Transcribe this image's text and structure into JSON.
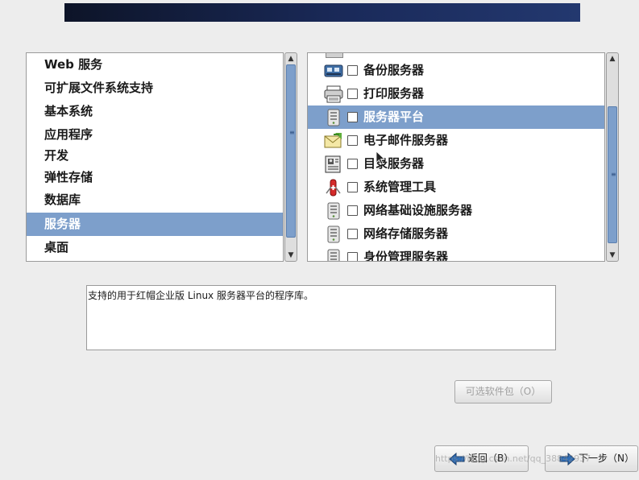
{
  "left_list": {
    "items": [
      {
        "label": "Web 服务"
      },
      {
        "label": "可扩展文件系统支持"
      },
      {
        "label": "基本系统"
      },
      {
        "label": "应用程序"
      },
      {
        "label": "开发"
      },
      {
        "label": "弹性存储"
      },
      {
        "label": "数据库"
      },
      {
        "label": "服务器",
        "selected": true
      },
      {
        "label": "桌面"
      }
    ]
  },
  "right_list": {
    "items": [
      {
        "label": "备份服务器",
        "icon": "backup-server-icon",
        "checked": false
      },
      {
        "label": "打印服务器",
        "icon": "printer-icon",
        "checked": false
      },
      {
        "label": "服务器平台",
        "icon": "server-icon",
        "checked": false,
        "selected": true
      },
      {
        "label": "电子邮件服务器",
        "icon": "mail-server-icon",
        "checked": false
      },
      {
        "label": "目录服务器",
        "icon": "directory-server-icon",
        "checked": false
      },
      {
        "label": "系统管理工具",
        "icon": "admin-tools-icon",
        "checked": false
      },
      {
        "label": "网络基础设施服务器",
        "icon": "server-icon",
        "checked": false
      },
      {
        "label": "网络存储服务器",
        "icon": "server-icon",
        "checked": false
      },
      {
        "label": "身份管理服务器",
        "icon": "server-icon",
        "checked": false
      }
    ]
  },
  "description": "支持的用于红帽企业版 Linux 服务器平台的程序库。",
  "buttons": {
    "optional_packages": "可选软件包（O）",
    "back": "返回（B）",
    "next": "下一步（N）"
  },
  "watermark": "https://blog.csdn.net/qq_38842937",
  "colors": {
    "selection": "#7d9fcb",
    "banner": "#1a2a5a"
  }
}
